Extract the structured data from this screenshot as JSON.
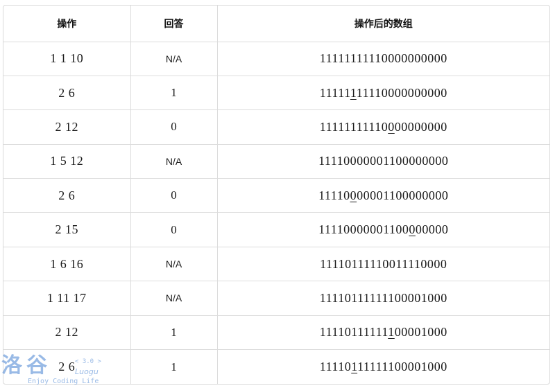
{
  "headers": [
    "操作",
    "回答",
    "操作后的数组"
  ],
  "rows": [
    {
      "op": "1 1 10",
      "answer": "N/A",
      "result": [
        "11111111110000000000",
        "",
        ""
      ]
    },
    {
      "op": "2 6",
      "answer": "1",
      "result": [
        "11111",
        "1",
        "11110000000000"
      ]
    },
    {
      "op": "2 12",
      "answer": "0",
      "result": [
        "11111111110",
        "0",
        "00000000"
      ]
    },
    {
      "op": "1 5 12",
      "answer": "N/A",
      "result": [
        "11110000001100000000",
        "",
        ""
      ]
    },
    {
      "op": "2 6",
      "answer": "0",
      "result": [
        "11110",
        "0",
        "00001100000000"
      ]
    },
    {
      "op": "2 15",
      "answer": "0",
      "result": [
        "11110000001100",
        "0",
        "00000"
      ]
    },
    {
      "op": "1 6 16",
      "answer": "N/A",
      "result": [
        "11110111110011110000",
        "",
        ""
      ]
    },
    {
      "op": "1 11 17",
      "answer": "N/A",
      "result": [
        "11110111111100001000",
        "",
        ""
      ]
    },
    {
      "op": "2 12",
      "answer": "1",
      "result": [
        "11110111111",
        "1",
        "00001000"
      ]
    },
    {
      "op": "2 6",
      "answer": "1",
      "result": [
        "11110",
        "1",
        "11111100001000"
      ]
    }
  ],
  "watermark": {
    "logo": "洛谷",
    "version": "< 3.0 >",
    "brand": "Luogu",
    "slogan": "Enjoy Coding Life"
  }
}
